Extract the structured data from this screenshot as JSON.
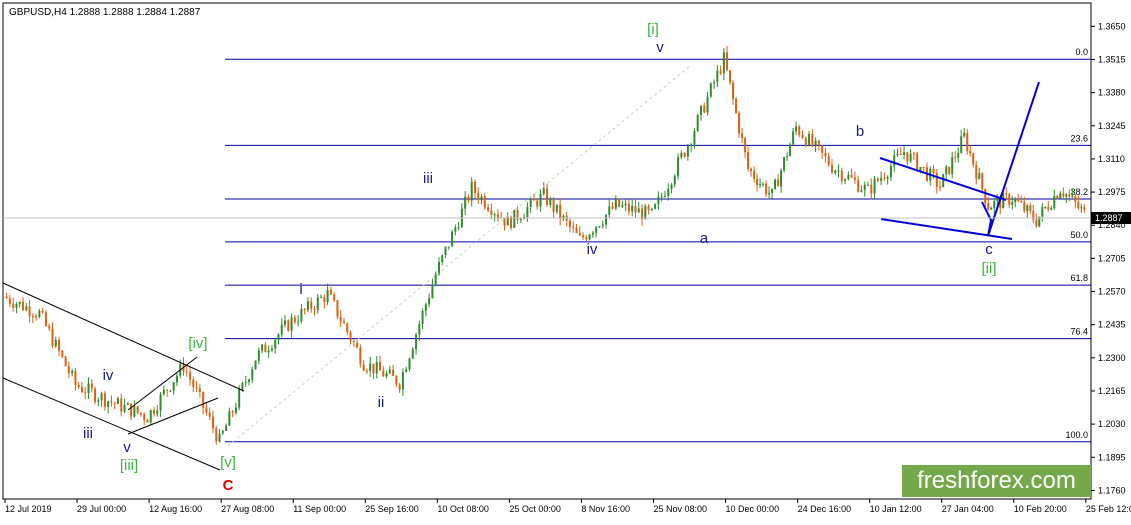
{
  "symbol_header": "GBPUSD,H4  1.2888 1.2888 1.2884 1.2887",
  "watermark": "freshforex.com",
  "chart_data": {
    "type": "line",
    "title": "GBPUSD,H4  1.2888 1.2888 1.2884 1.2887",
    "ylim": [
      1.1725,
      1.3745
    ],
    "y_ticks": [
      "1.3650",
      "1.3515",
      "1.3380",
      "1.3245",
      "1.3110",
      "1.2975",
      "1.2840",
      "1.2705",
      "1.2570",
      "1.2435",
      "1.2300",
      "1.2165",
      "1.2030",
      "1.1895",
      "1.1760"
    ],
    "x_ticks": [
      "12 Jul 2019",
      "29 Jul 00:00",
      "12 Aug 16:00",
      "27 Aug 08:00",
      "11 Sep 00:00",
      "25 Sep 16:00",
      "10 Oct 08:00",
      "25 Oct 00:00",
      "8 Nov 16:00",
      "25 Nov 08:00",
      "10 Dec 00:00",
      "24 Dec 16:00",
      "10 Jan 12:00",
      "27 Jan 04:00",
      "10 Feb 20:00",
      "25 Feb 12:00"
    ],
    "current_price": "1.2887",
    "fib_levels": [
      {
        "label": "0.0",
        "price": 1.3516
      },
      {
        "label": "23.6",
        "price": 1.3165
      },
      {
        "label": "38.2",
        "price": 1.2947
      },
      {
        "label": "50.0",
        "price": 1.2772
      },
      {
        "label": "61.8",
        "price": 1.2596
      },
      {
        "label": "76.4",
        "price": 1.2378
      },
      {
        "label": "100.0",
        "price": 1.1958
      }
    ],
    "price_path": [
      {
        "x": "12 Jul 2019",
        "y": 1.255
      },
      {
        "x": "20 Jul",
        "y": 1.248
      },
      {
        "x": "29 Jul 00:00",
        "y": 1.219
      },
      {
        "x": "5 Aug",
        "y": 1.212
      },
      {
        "x": "12 Aug 16:00",
        "y": 1.206
      },
      {
        "x": "20 Aug",
        "y": 1.227
      },
      {
        "x": "27 Aug 08:00",
        "y": 1.196
      },
      {
        "x": "4 Sep",
        "y": 1.23
      },
      {
        "x": "11 Sep 00:00",
        "y": 1.245
      },
      {
        "x": "18 Sep",
        "y": 1.256
      },
      {
        "x": "25 Sep 16:00",
        "y": 1.228
      },
      {
        "x": "3 Oct",
        "y": 1.22
      },
      {
        "x": "10 Oct 08:00",
        "y": 1.264
      },
      {
        "x": "17 Oct",
        "y": 1.299
      },
      {
        "x": "25 Oct 00:00",
        "y": 1.285
      },
      {
        "x": "1 Nov",
        "y": 1.296
      },
      {
        "x": "8 Nov 16:00",
        "y": 1.278
      },
      {
        "x": "18 Nov",
        "y": 1.292
      },
      {
        "x": "25 Nov 08:00",
        "y": 1.288
      },
      {
        "x": "4 Dec",
        "y": 1.317
      },
      {
        "x": "10 Dec 00:00",
        "y": 1.3516
      },
      {
        "x": "17 Dec",
        "y": 1.307
      },
      {
        "x": "20 Dec",
        "y": 1.296
      },
      {
        "x": "24 Dec 16:00",
        "y": 1.324
      },
      {
        "x": "2 Jan",
        "y": 1.308
      },
      {
        "x": "10 Jan 12:00",
        "y": 1.298
      },
      {
        "x": "20 Jan",
        "y": 1.314
      },
      {
        "x": "27 Jan 04:00",
        "y": 1.3
      },
      {
        "x": "1 Feb",
        "y": 1.32
      },
      {
        "x": "6 Feb",
        "y": 1.292
      },
      {
        "x": "10 Feb 20:00",
        "y": 1.295
      },
      {
        "x": "18 Feb",
        "y": 1.286
      },
      {
        "x": "21 Feb",
        "y": 1.299
      },
      {
        "x": "25 Feb 12:00",
        "y": 1.2887
      }
    ],
    "wave_labels": [
      {
        "text": "[i]",
        "color": "#3cb43c"
      },
      {
        "text": "v",
        "color": "#1a1a80"
      },
      {
        "text": "iii",
        "color": "#1a1a80"
      },
      {
        "text": "iv",
        "color": "#1a1a80"
      },
      {
        "text": "b",
        "color": "#1a1a80"
      },
      {
        "text": "a",
        "color": "#1a1a80"
      },
      {
        "text": "c",
        "color": "#1a1a80"
      },
      {
        "text": "[ii]",
        "color": "#3cb43c"
      },
      {
        "text": "i",
        "color": "#1a1a80"
      },
      {
        "text": "ii",
        "color": "#1a1a80"
      },
      {
        "text": "[iv]",
        "color": "#3cb43c"
      },
      {
        "text": "iv",
        "color": "#1a1a80"
      },
      {
        "text": "iii",
        "color": "#1a1a80"
      },
      {
        "text": "v",
        "color": "#1a1a80"
      },
      {
        "text": "[iii]",
        "color": "#3cb43c"
      },
      {
        "text": "[v]",
        "color": "#3cb43c"
      },
      {
        "text": "C",
        "color": "#e00000"
      }
    ],
    "colors": {
      "bull": "#2e8b2e",
      "bear": "#e06010",
      "fib_line": "#0000a0",
      "channel": "#000000",
      "forecast": "#0000e0"
    }
  }
}
